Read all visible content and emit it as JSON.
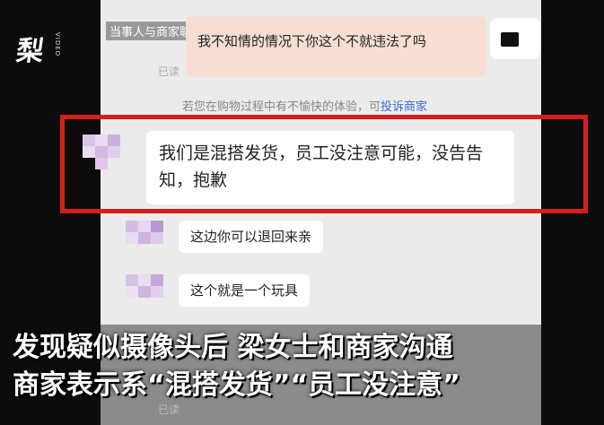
{
  "logo": {
    "text": "梨",
    "sub": "VIDEO"
  },
  "caption_top": "当事人与商家聊天记录",
  "messages": {
    "self_msg": "我不知情的情况下你这个不就违法了吗",
    "read_label": "已读",
    "notice_text": "若您在购物过程中有不愉快的体验，可",
    "notice_link": "投诉商家",
    "merchant_reply_1": "我们是混搭发货，员工没注意可能，没告告知，抱歉",
    "merchant_reply_2": "这边你可以退回来亲",
    "merchant_reply_3": "这个就是一个玩具",
    "bottom_read": "已读"
  },
  "subtitles": {
    "line1": "发现疑似摄像头后 梁女士和商家沟通",
    "line2": "商家表示系“混搭发货”“员工没注意”"
  },
  "colors": {
    "highlight": "#d61e1e",
    "link": "#3a6ad6",
    "self_bubble": "#f6ded4"
  }
}
